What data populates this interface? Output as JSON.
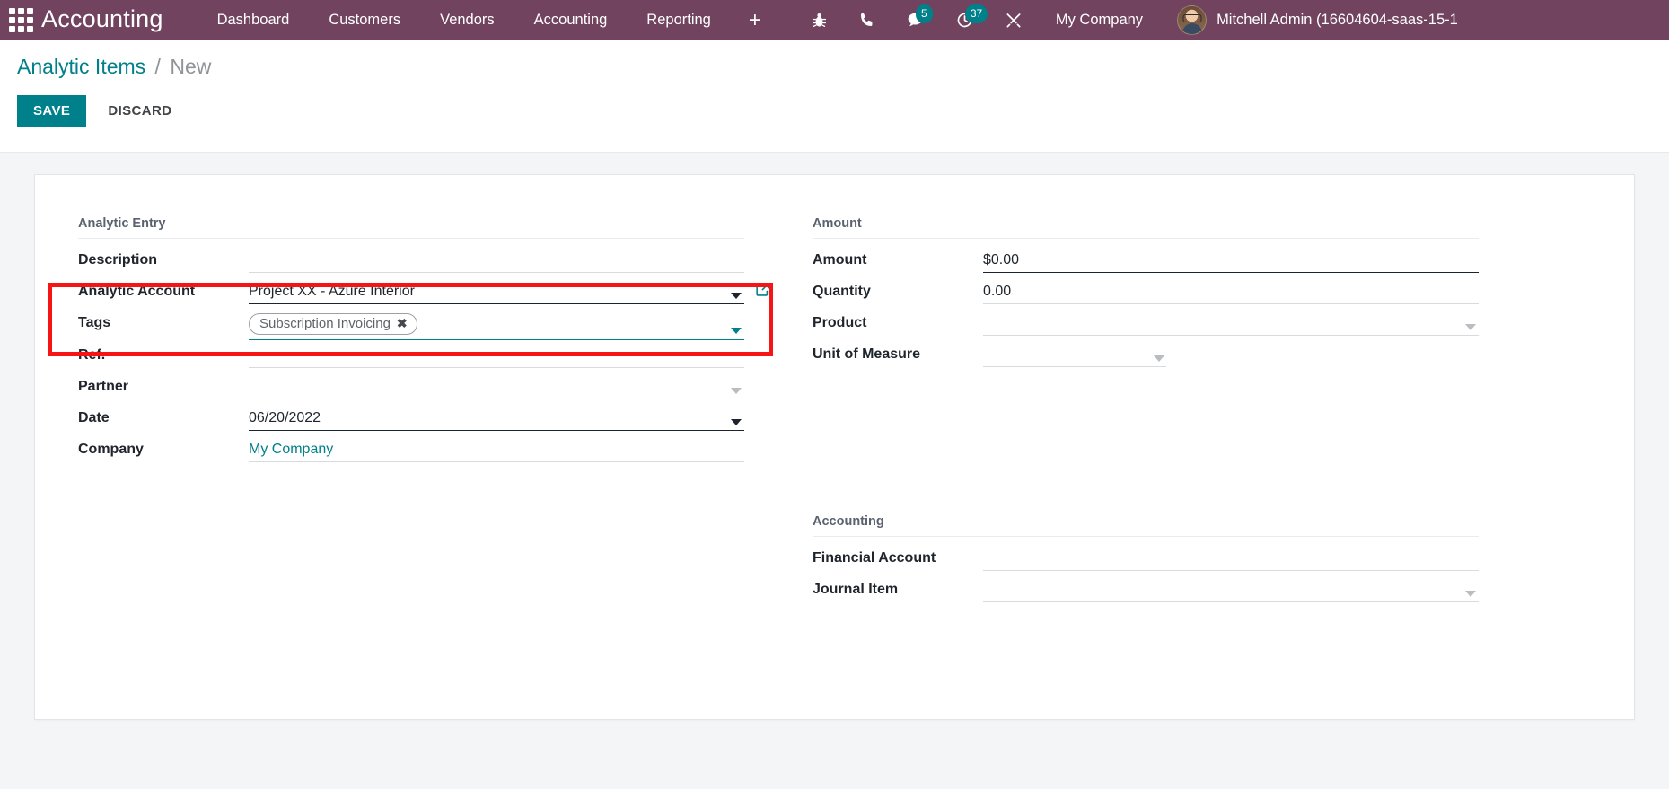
{
  "navbar": {
    "apps_icon": "apps-grid-icon",
    "brand": "Accounting",
    "menus": [
      {
        "label": "Dashboard"
      },
      {
        "label": "Customers"
      },
      {
        "label": "Vendors"
      },
      {
        "label": "Accounting"
      },
      {
        "label": "Reporting"
      }
    ],
    "plus_label": "+",
    "icons": [
      {
        "name": "bug-icon",
        "badge": null
      },
      {
        "name": "phone-icon",
        "badge": null
      },
      {
        "name": "messages-icon",
        "badge": "5"
      },
      {
        "name": "activity-clock-icon",
        "badge": "37"
      },
      {
        "name": "tools-icon",
        "badge": null
      }
    ],
    "company": "My Company",
    "user": "Mitchell Admin (16604604-saas-15-1"
  },
  "control_panel": {
    "breadcrumb_root": "Analytic Items",
    "breadcrumb_sep": "/",
    "breadcrumb_current": "New",
    "save_label": "SAVE",
    "discard_label": "DISCARD"
  },
  "form": {
    "left": {
      "group_title": "Analytic Entry",
      "fields": [
        {
          "label": "Description",
          "value": "",
          "placeholder": ""
        },
        {
          "label": "Analytic Account",
          "value": "Project XX - Azure Interior",
          "placeholder": ""
        },
        {
          "label": "Tags",
          "value": "",
          "placeholder": ""
        },
        {
          "label": "Ref.",
          "value": "",
          "placeholder": ""
        },
        {
          "label": "Partner",
          "value": "",
          "placeholder": ""
        },
        {
          "label": "Date",
          "value": "06/20/2022",
          "placeholder": ""
        },
        {
          "label": "Company",
          "value": "My Company",
          "placeholder": ""
        }
      ],
      "tag_chip": "Subscription Invoicing",
      "tag_chip_remove": "✖"
    },
    "right": {
      "group_title_amount": "Amount",
      "amount_fields": [
        {
          "label": "Amount",
          "value": "$0.00",
          "placeholder": ""
        },
        {
          "label": "Quantity",
          "value": "0.00",
          "placeholder": ""
        },
        {
          "label": "Product",
          "value": "",
          "placeholder": ""
        },
        {
          "label": "Unit of Measure",
          "value": "",
          "placeholder": ""
        }
      ],
      "group_title_accounting": "Accounting",
      "accounting_fields": [
        {
          "label": "Financial Account",
          "value": "",
          "placeholder": ""
        },
        {
          "label": "Journal Item",
          "value": "",
          "placeholder": ""
        }
      ]
    }
  },
  "annotation": {
    "highlight_color": "#f61414",
    "highlight_target": "analytic-account-and-tags"
  },
  "colors": {
    "navbar": "#71435f",
    "accent_teal": "#00808a",
    "badge": "#00808a",
    "sheet_bg": "#f4f5f7"
  }
}
